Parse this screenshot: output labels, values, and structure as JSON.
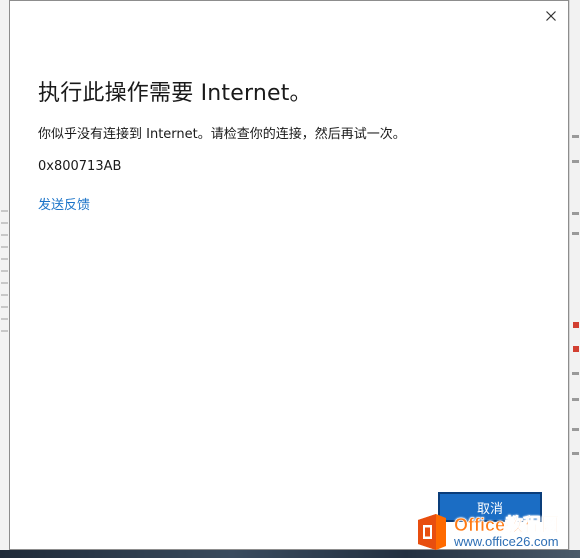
{
  "dialog": {
    "title": "执行此操作需要 Internet。",
    "message": "你似乎没有连接到 Internet。请检查你的连接，然后再试一次。",
    "error_code": "0x800713AB",
    "feedback_link": "发送反馈",
    "close_icon": "close-icon",
    "cancel_label": "取消",
    "accent_color": "#1b6dc4"
  },
  "watermark": {
    "line1": "Office教程网",
    "line2": "www.office26.com",
    "logo_icon": "office-logo-icon",
    "brand_color": "#ff7a14"
  }
}
